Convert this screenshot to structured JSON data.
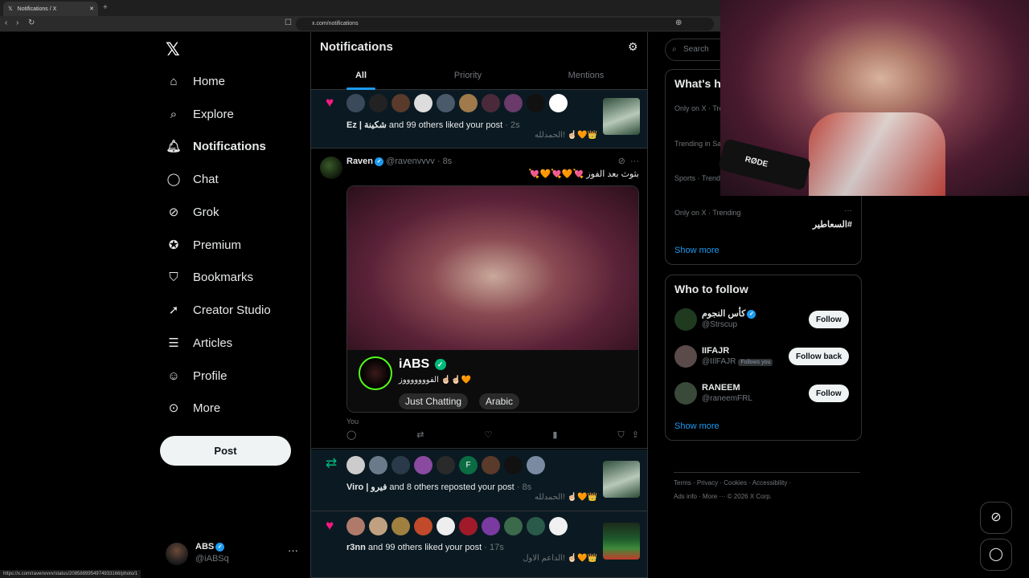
{
  "browser": {
    "tab_title": "Notifications / X",
    "url": "x.com/notifications",
    "status_url": "https://x.com/ravenvvvv/status/2085889954974933166/photo/1"
  },
  "sidebar": {
    "items": [
      {
        "label": "Home",
        "icon": "home-icon"
      },
      {
        "label": "Explore",
        "icon": "search-icon"
      },
      {
        "label": "Notifications",
        "icon": "bell-icon"
      },
      {
        "label": "Chat",
        "icon": "chat-icon"
      },
      {
        "label": "Grok",
        "icon": "grok-icon"
      },
      {
        "label": "Premium",
        "icon": "premium-icon"
      },
      {
        "label": "Bookmarks",
        "icon": "bookmark-icon"
      },
      {
        "label": "Creator Studio",
        "icon": "rocket-icon"
      },
      {
        "label": "Articles",
        "icon": "articles-icon"
      },
      {
        "label": "Profile",
        "icon": "profile-icon"
      },
      {
        "label": "More",
        "icon": "more-icon"
      }
    ],
    "post_label": "Post",
    "account": {
      "name": "ABS",
      "handle": "@iABSq"
    }
  },
  "main": {
    "title": "Notifications",
    "tabs": [
      "All",
      "Priority",
      "Mentions"
    ],
    "notifications": [
      {
        "type": "like",
        "actor": "Ez | شكينة",
        "text": "and 99 others liked your post",
        "time": "· 2s",
        "quote": "الحمدلله! ☝🏻🧡👑"
      },
      {
        "type": "repost",
        "actor": "Viro | فيرو",
        "text": "and 8 others reposted your post",
        "time": "· 8s",
        "quote": "الحمدلله! ☝🏻🧡👑"
      },
      {
        "type": "like",
        "actor": "r3nn",
        "text": "and 99 others liked your post",
        "time": "· 17s",
        "quote": "الداعم الاول! ☝🏻🧡👑"
      }
    ],
    "repost_avatar_letter": "F",
    "tweet": {
      "name": "Raven",
      "handle": "@ravenvvvv",
      "time": "· 8s",
      "text": "بثوث بعد الفوز 💘🧡💘🧡💘",
      "stream": {
        "name": "iABS",
        "title": "الفوووووووز ☝🏻☝🏻🧡",
        "tags": [
          "Just Chatting",
          "Arabic"
        ]
      },
      "you_label": "You"
    }
  },
  "right": {
    "search_placeholder": "Search",
    "trends_title": "What's h",
    "trends": [
      {
        "meta": "Only on X · Tre",
        "name": ""
      },
      {
        "meta": "Trending in Sa",
        "name": ""
      },
      {
        "meta": "Sports · Trend",
        "name": ""
      },
      {
        "meta": "Only on X · Trending",
        "name": "#السعاطير"
      }
    ],
    "show_more": "Show more",
    "who_title": "Who to follow",
    "who": [
      {
        "name": "كأس النجوم",
        "handle": "@Strscup",
        "button": "Follow",
        "follows_you": ""
      },
      {
        "name": "IIFAJR",
        "handle": "@IIlFAJR",
        "button": "Follow back",
        "follows_you": "Follows you"
      },
      {
        "name": "RANEEM",
        "handle": "@raneemFRL",
        "button": "Follow",
        "follows_you": ""
      }
    ],
    "footer": {
      "line1": "Terms · Privacy · Cookies · Accessibility ·",
      "line2": "Ads info · More ··· © 2026 X Corp."
    }
  },
  "webcam": {
    "mic_label": "RØDE"
  },
  "colors": {
    "accent": "#1d9bf0",
    "like": "#f91880",
    "repost": "#00ba7c",
    "kick_green": "#53fc18"
  }
}
